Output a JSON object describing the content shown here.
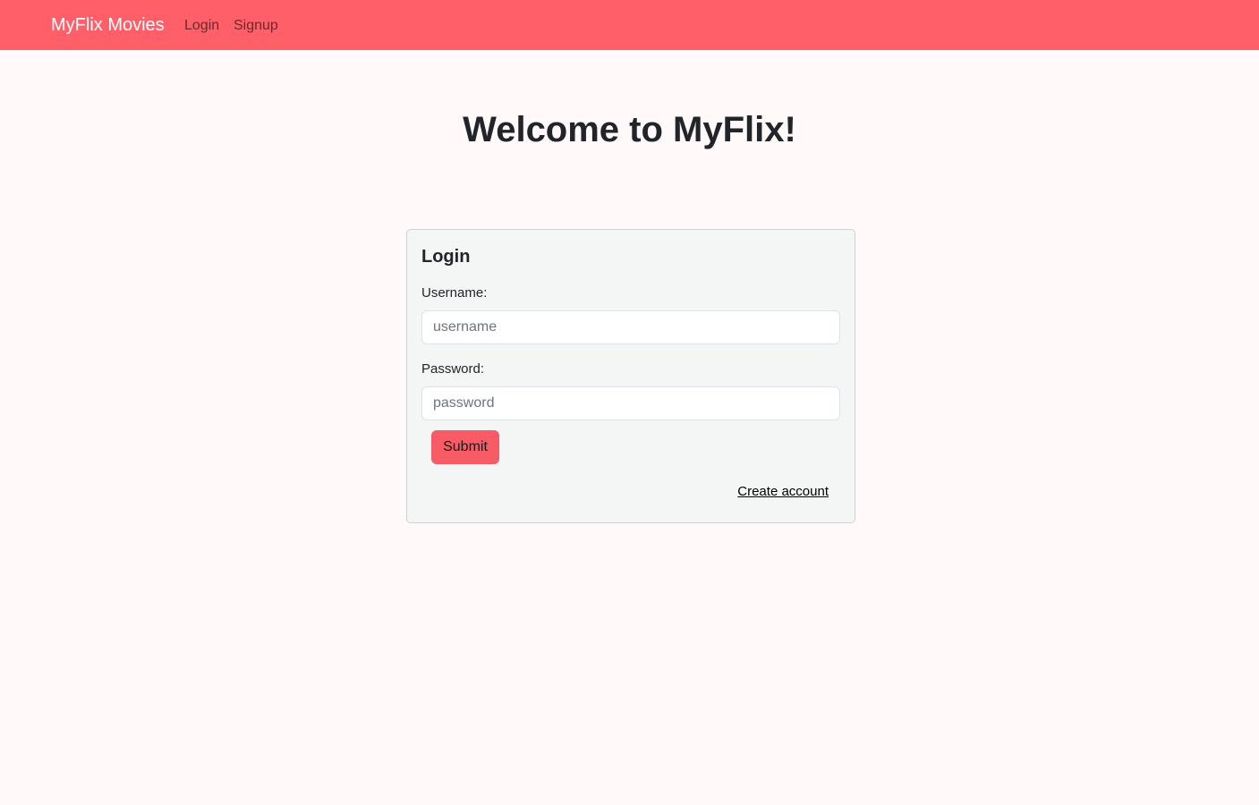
{
  "navbar": {
    "brand": "MyFlix Movies",
    "links": [
      {
        "label": "Login"
      },
      {
        "label": "Signup"
      }
    ],
    "background_color": "#ff5f68"
  },
  "main": {
    "title": "Welcome to MyFlix!"
  },
  "login_card": {
    "title": "Login",
    "username_label": "Username:",
    "username_placeholder": "username",
    "username_value": "",
    "password_label": "Password:",
    "password_placeholder": "password",
    "password_value": "",
    "submit_label": "Submit",
    "create_account_label": "Create account",
    "accent_color": "#f65b66"
  }
}
